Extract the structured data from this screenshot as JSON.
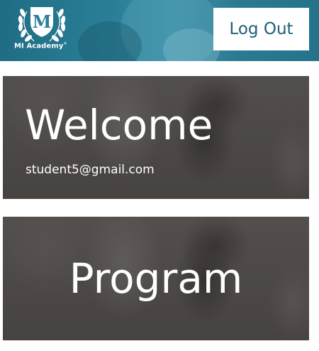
{
  "header": {
    "logo_text": "MI Academy",
    "logo_mark": "®",
    "logo_letter": "M",
    "logout_label": "Log Out",
    "background_color": "#2a7f97"
  },
  "cards": {
    "welcome": {
      "title": "Welcome",
      "email": "student5@gmail.com"
    },
    "program": {
      "title": "Program"
    }
  },
  "icons": {
    "logo": "laurel-wreath-m-logo-icon"
  },
  "colors": {
    "logout_text": "#1d5f76",
    "card_overlay": "#3c3837"
  }
}
